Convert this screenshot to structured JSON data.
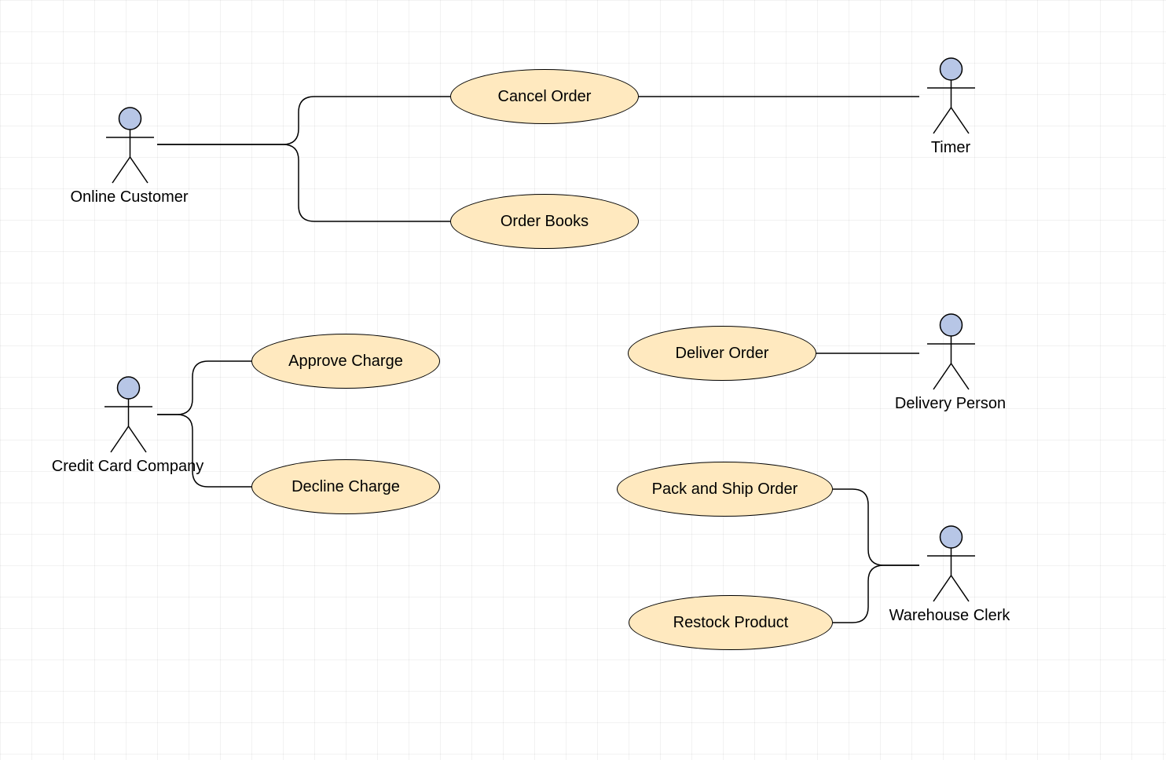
{
  "actors": {
    "online_customer": "Online Customer",
    "timer": "Timer",
    "credit_card_company": "Credit Card Company",
    "delivery_person": "Delivery Person",
    "warehouse_clerk": "Warehouse Clerk"
  },
  "usecases": {
    "cancel_order": "Cancel Order",
    "order_books": "Order Books",
    "approve_charge": "Approve Charge",
    "decline_charge": "Decline Charge",
    "deliver_order": "Deliver Order",
    "pack_and_ship_order": "Pack and Ship Order",
    "restock_product": "Restock Product"
  },
  "associations": [
    [
      "online_customer",
      "cancel_order"
    ],
    [
      "online_customer",
      "order_books"
    ],
    [
      "timer",
      "cancel_order"
    ],
    [
      "credit_card_company",
      "approve_charge"
    ],
    [
      "credit_card_company",
      "decline_charge"
    ],
    [
      "delivery_person",
      "deliver_order"
    ],
    [
      "warehouse_clerk",
      "pack_and_ship_order"
    ],
    [
      "warehouse_clerk",
      "restock_product"
    ]
  ]
}
